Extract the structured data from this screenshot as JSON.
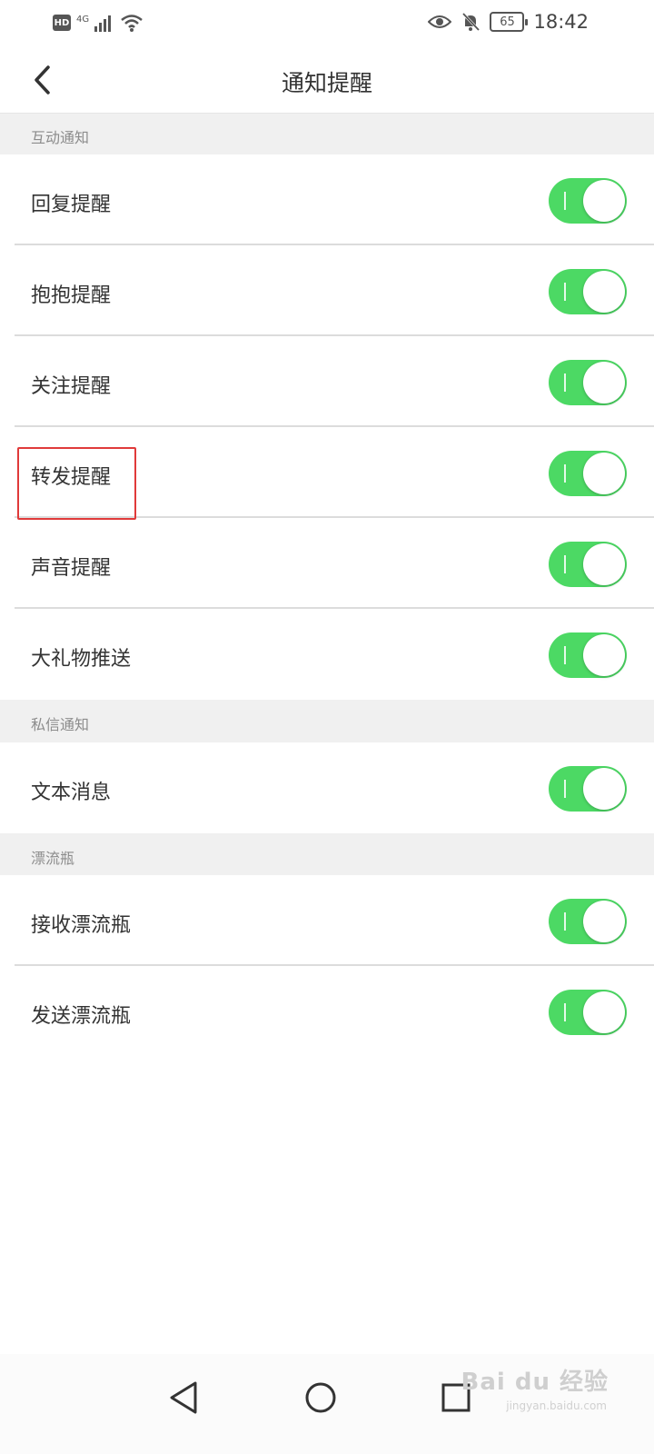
{
  "status_bar": {
    "hd": "HD",
    "network": "4G",
    "battery": "65",
    "time": "18:42"
  },
  "header": {
    "title": "通知提醒"
  },
  "sections": [
    {
      "title": "互动通知",
      "items": [
        {
          "label": "回复提醒",
          "enabled": true
        },
        {
          "label": "抱抱提醒",
          "enabled": true
        },
        {
          "label": "关注提醒",
          "enabled": true
        },
        {
          "label": "转发提醒",
          "enabled": true
        },
        {
          "label": "声音提醒",
          "enabled": true
        },
        {
          "label": "大礼物推送",
          "enabled": true
        }
      ]
    },
    {
      "title": "私信通知",
      "items": [
        {
          "label": "文本消息",
          "enabled": true
        }
      ]
    },
    {
      "title": "漂流瓶",
      "items": [
        {
          "label": "接收漂流瓶",
          "enabled": true
        },
        {
          "label": "发送漂流瓶",
          "enabled": true
        }
      ]
    }
  ],
  "colors": {
    "toggle_on": "#4cd964",
    "highlight": "#e03a3a",
    "section_bg": "#f0f0f0"
  },
  "watermark": {
    "text": "Bai du 经验",
    "sub": "jingyan.baidu.com"
  }
}
